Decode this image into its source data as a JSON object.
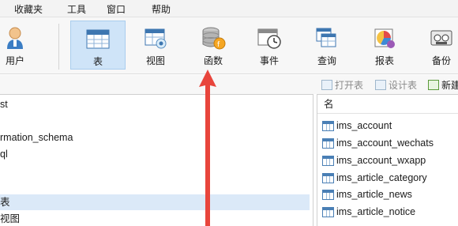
{
  "menubar": {
    "items": [
      "收藏夹",
      "工具",
      "窗口",
      "帮助"
    ]
  },
  "toolbar": {
    "items": [
      {
        "label": "用户",
        "icon": "user-icon"
      },
      {
        "label": "表",
        "icon": "table-icon",
        "active": true
      },
      {
        "label": "视图",
        "icon": "view-icon"
      },
      {
        "label": "函数",
        "icon": "function-icon"
      },
      {
        "label": "事件",
        "icon": "event-icon"
      },
      {
        "label": "查询",
        "icon": "query-icon"
      },
      {
        "label": "报表",
        "icon": "report-icon"
      },
      {
        "label": "备份",
        "icon": "backup-icon"
      }
    ]
  },
  "subbar": {
    "open_table": "打开表",
    "design_table": "设计表",
    "new_table": "新建"
  },
  "tree": {
    "items": [
      {
        "label": "st"
      },
      {
        "label": "rmation_schema"
      },
      {
        "label": "ql"
      },
      {
        "label": "表",
        "selected": true
      },
      {
        "label": "视图"
      }
    ]
  },
  "table_list": {
    "header": "名",
    "rows": [
      "ims_account",
      "ims_account_wechats",
      "ims_account_wxapp",
      "ims_article_category",
      "ims_article_news",
      "ims_article_notice"
    ]
  },
  "colors": {
    "active_tool_bg": "#cfe4f8",
    "selection_bg": "#dbe9f8",
    "arrow_red": "#e8453c"
  }
}
